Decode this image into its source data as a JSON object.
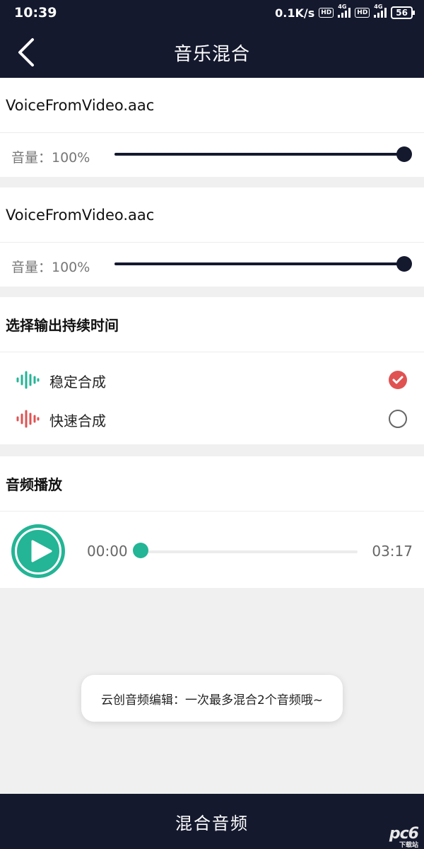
{
  "status_bar": {
    "time": "10:39",
    "net_speed": "0.1K/s",
    "hd_badge_1": "HD",
    "hd_badge_2": "HD",
    "signal_1_label": "4G",
    "signal_2_label": "4G",
    "battery": "56"
  },
  "navbar": {
    "title": "音乐混合",
    "back_icon": "chevron-left-icon"
  },
  "tracks": [
    {
      "name": "VoiceFromVideo.aac",
      "volume_label": "音量：100%",
      "volume_fraction": 1.0
    },
    {
      "name": "VoiceFromVideo.aac",
      "volume_label": "音量：100%",
      "volume_fraction": 1.0
    }
  ],
  "duration_section": {
    "title": "选择输出持续时间",
    "options": [
      {
        "label": "稳定合成",
        "selected": true,
        "icon": "waveform-icon",
        "color": "#23b595"
      },
      {
        "label": "快速合成",
        "selected": false,
        "icon": "waveform-icon",
        "color": "#e05252"
      }
    ]
  },
  "playback": {
    "title": "音频播放",
    "current_time": "00:00",
    "total_time": "03:17",
    "progress_fraction": 0.0
  },
  "toast": {
    "text": "云创音频编辑：一次最多混合2个音频哦~"
  },
  "bottom_button": {
    "label": "混合音频"
  },
  "watermark": {
    "text": "pc6",
    "sub": "下载站"
  },
  "colors": {
    "dark": "#14192e",
    "accent": "#23b595",
    "danger": "#e05252",
    "background": "#f0f0f0"
  }
}
